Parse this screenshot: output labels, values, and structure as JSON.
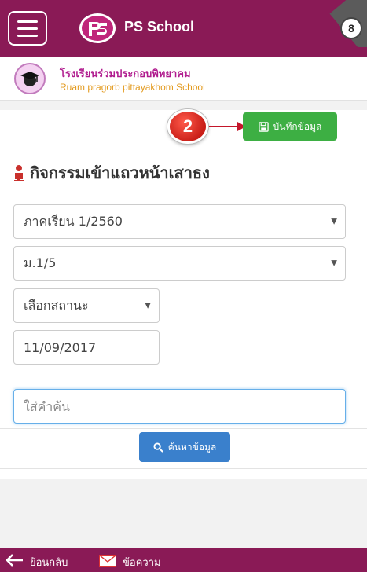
{
  "appbar": {
    "title": "PS School",
    "menu_icon": "hamburger-menu-icon",
    "logo_icon": "ps-logo-icon",
    "badge_text": "8"
  },
  "school": {
    "name_th": "โรงเรียนร่วมประกอบพิทยาคม",
    "name_en": "Ruam pragorb pittayakhom School",
    "logo_icon": "school-crest-icon"
  },
  "annotation": {
    "step_number": "2",
    "arrow_icon": "red-arrow-icon"
  },
  "toolbar": {
    "save_label": "บันทึกข้อมูล",
    "save_icon": "floppy-disk-icon"
  },
  "page": {
    "heading": "กิจกรรมเข้าแถวหน้าเสาธง",
    "heading_icon": "person-icon"
  },
  "filters": {
    "term_value": "ภาคเรียน 1/2560",
    "class_value": "ม.1/5",
    "status_value": "เลือกสถานะ",
    "date_value": "11/09/2017",
    "search_placeholder": "ใส่คำค้น",
    "search_value": ""
  },
  "search": {
    "button_label": "ค้นหาข้อมูล",
    "button_icon": "magnifier-icon"
  },
  "bottombar": {
    "back_label": "ย้อนกลับ",
    "back_icon": "back-arrow-icon",
    "message_label": "ข้อความ",
    "message_icon": "envelope-icon"
  },
  "colors": {
    "brand": "#8a1a56",
    "save_button": "#3daf43",
    "search_button": "#3a80cc",
    "annotation": "#c91e18",
    "school_name": "#b01b8e",
    "school_name_en": "#e39a1e"
  }
}
